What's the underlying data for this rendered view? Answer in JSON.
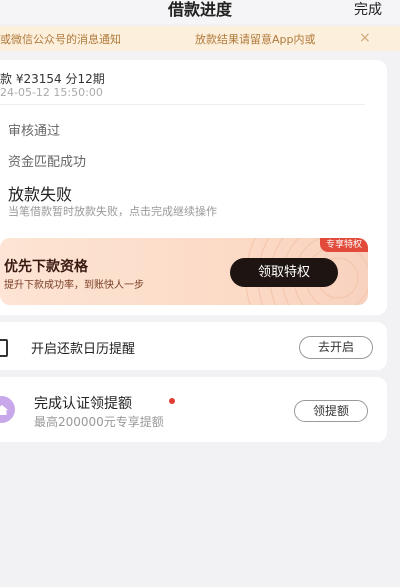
{
  "header": {
    "title": "借款进度",
    "done_label": "完成"
  },
  "notice": {
    "text_left": "或微信公众号的消息通知",
    "text_right": "放款结果请留意App内或",
    "close_glyph": "×"
  },
  "loan": {
    "amount_line": "款 ¥23154  分12期",
    "datetime": "24-05-12 15:50:00"
  },
  "steps": [
    {
      "label": "审核通过"
    },
    {
      "label": "资金匹配成功"
    },
    {
      "label": "放款失败",
      "desc": "当笔借款暂时放款失败，点击完成继续操作"
    }
  ],
  "promo": {
    "tag": "专享特权",
    "title": "优先下款资格",
    "subtitle": "提升下款成功率，到账快人一步",
    "button": "领取特权"
  },
  "calendar": {
    "label": "开启还款日历提醒",
    "button": "去开启"
  },
  "auth": {
    "title": "完成认证领提额",
    "subtitle": "最高200000元专享提额",
    "button": "领提额"
  },
  "colors": {
    "accent_dark": "#1e1411",
    "red": "#e03c31",
    "notice_text": "#b07a3c"
  }
}
